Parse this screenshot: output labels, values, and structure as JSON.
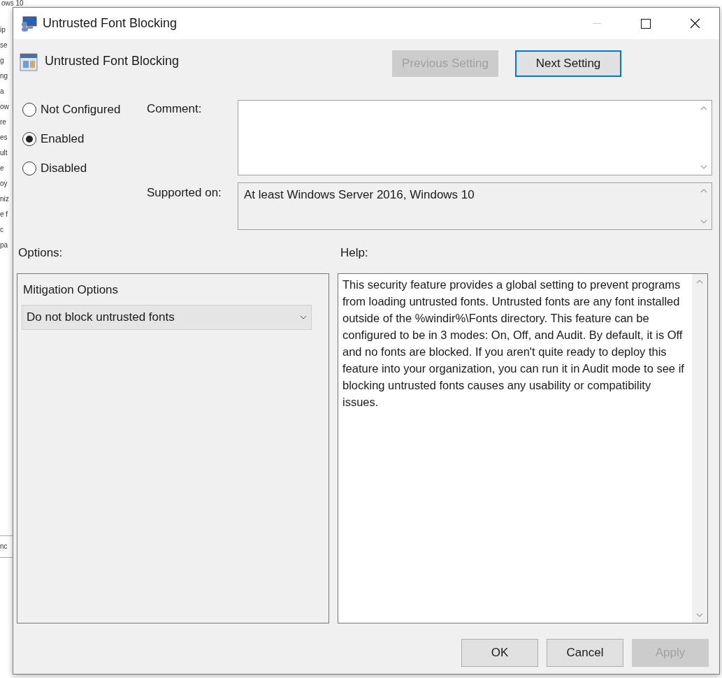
{
  "background_window": {
    "title_fragment": "ows 10",
    "text_fragments": [
      "ip",
      "se",
      "g",
      "ng",
      "a",
      "ow",
      "re",
      "es",
      "ult",
      "e",
      "oy",
      "niz",
      "e f",
      "c",
      "pa"
    ],
    "lower_fragment": "nc"
  },
  "window": {
    "title": "Untrusted Font Blocking"
  },
  "setting": {
    "name": "Untrusted Font Blocking"
  },
  "nav_buttons": [
    {
      "label": "Previous Setting",
      "disabled": true,
      "focused": false
    },
    {
      "label": "Next Setting",
      "disabled": false,
      "focused": true
    }
  ],
  "states": [
    {
      "label": "Not Configured",
      "selected": false
    },
    {
      "label": "Enabled",
      "selected": true
    },
    {
      "label": "Disabled",
      "selected": false
    }
  ],
  "comment": {
    "label": "Comment:"
  },
  "supported_on": {
    "label": "Supported on:",
    "value": "At least Windows Server 2016, Windows 10"
  },
  "options": {
    "label": "Options:",
    "group_label": "Mitigation Options",
    "dropdown_value": "Do not block untrusted fonts"
  },
  "help": {
    "label": "Help:",
    "text": "This security feature provides a global setting to prevent programs from loading untrusted fonts. Untrusted fonts are any font installed outside of the %windir%\\Fonts directory. This feature can be configured to be in 3 modes: On, Off, and Audit. By default, it is Off and no fonts are blocked. If you aren't quite ready to deploy this feature into your organization, you can run it in Audit mode to see if blocking untrusted fonts causes any usability or compatibility issues."
  },
  "buttons": [
    {
      "label": "OK",
      "disabled": false
    },
    {
      "label": "Cancel",
      "disabled": false
    },
    {
      "label": "Apply",
      "disabled": true
    }
  ]
}
